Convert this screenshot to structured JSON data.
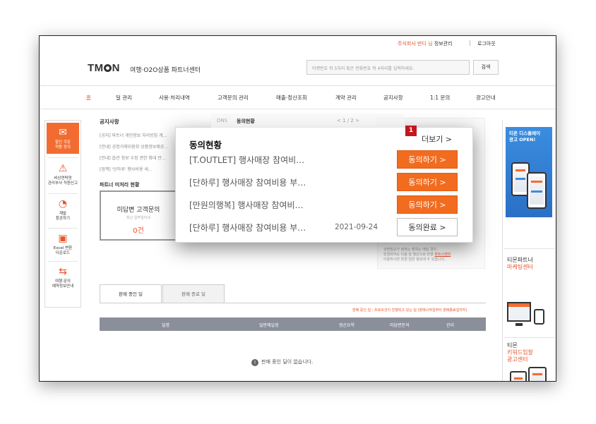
{
  "topbar": {
    "company": "주식회사 반디 님",
    "info": "정보관리",
    "logout": "로그아웃"
  },
  "header": {
    "logo": "TMON",
    "subtitle": "여행·O2O상품 파트너센터",
    "search_placeholder": "티켓번호 뒤 5자리 혹은 전화번호 뒤 4자리를 입력하세요.",
    "search_button": "검색"
  },
  "nav": [
    "홈",
    "딜 관리",
    "사용·처리내역",
    "고객문의 관리",
    "매출·정산조회",
    "계약 관리",
    "공지사항",
    "1:1 문의",
    "광고안내"
  ],
  "quick_menu": [
    {
      "icon": "coupon-icon",
      "label1": "할인 쿠폰",
      "label2": "적용 동의"
    },
    {
      "icon": "siren-icon",
      "label1": "비상연락망",
      "label2": "관리부서 직원신고"
    },
    {
      "icon": "clock-icon",
      "label1": "재발",
      "label2": "참관하기"
    },
    {
      "icon": "excel-icon",
      "label1": "Excel 변환",
      "label2": "다운로드"
    },
    {
      "icon": "ticket-icon",
      "label1": "여행·문의",
      "label2": "예약정보안내"
    }
  ],
  "notice": {
    "title": "공지사항",
    "items": [
      "[공지] 파트너 개인정보 처리방침 개…",
      "[안내] 공정거래위원회 상품정보제공…",
      "[안내] 옵션 정보 수정 권한 확대 안…",
      "[정책] '단하루' 행사비용 세…"
    ]
  },
  "partner": {
    "title": "파트너 미처리 현황",
    "card_title": "미답변 고객문의",
    "card_sub": "최근 일주일이내",
    "card_value": "0건"
  },
  "right_card_note": [
    "관련법규가 정하는 범위는 매달 경우,",
    "변경되어도 다음 달 정산으로 반영 ",
    "이용하시면 변경 일반 정보대 수 있습니다."
  ],
  "right_card_link": "파트너센터",
  "tabs": {
    "on": "판매 중인 딜",
    "off": "판매 종료 딜"
  },
  "sale_note": "판매 중인 딜 : 프로모션이 진행되고 있는 딜 (판매시작일부터 판매종료일까지)",
  "table_headers": [
    "딜명",
    "딜판매일정",
    "정산요약",
    "미답변문의",
    "관리"
  ],
  "empty_message": "판매 중인 딜이 없습니다.",
  "ads": {
    "banner1_line1": "티몬 디스플레이",
    "banner1_line2": "광고 OPEN!",
    "ad2_line1": "티몬파트너",
    "ad2_line2": "마케팅센터",
    "ad3_line1": "티몬",
    "ad3_line2": "키워드입찰",
    "ad3_line3": "광고센터",
    "monitor_logo": "TMON"
  },
  "popup": {
    "ghost_title": "동의현황",
    "ghost_prefix": "DNS",
    "ghost_page": "< 1 / 2 >",
    "badge": "1",
    "title": "동의현황",
    "more": "더보기 >",
    "rows": [
      {
        "text": "[T.OUTLET] 행사매장 참여비…",
        "date": "",
        "button": "동의하기 >",
        "status": "agree"
      },
      {
        "text": "[단하루] 행사매장 참여비용 부…",
        "date": "",
        "button": "동의하기 >",
        "status": "agree"
      },
      {
        "text": "[만원의행복] 행사매장 참여비…",
        "date": "",
        "button": "동의하기 >",
        "status": "agree"
      },
      {
        "text": "[단하루] 행사매장 참여비용 부…",
        "date": "2021-09-24",
        "button": "동의완료 >",
        "status": "done"
      }
    ]
  }
}
